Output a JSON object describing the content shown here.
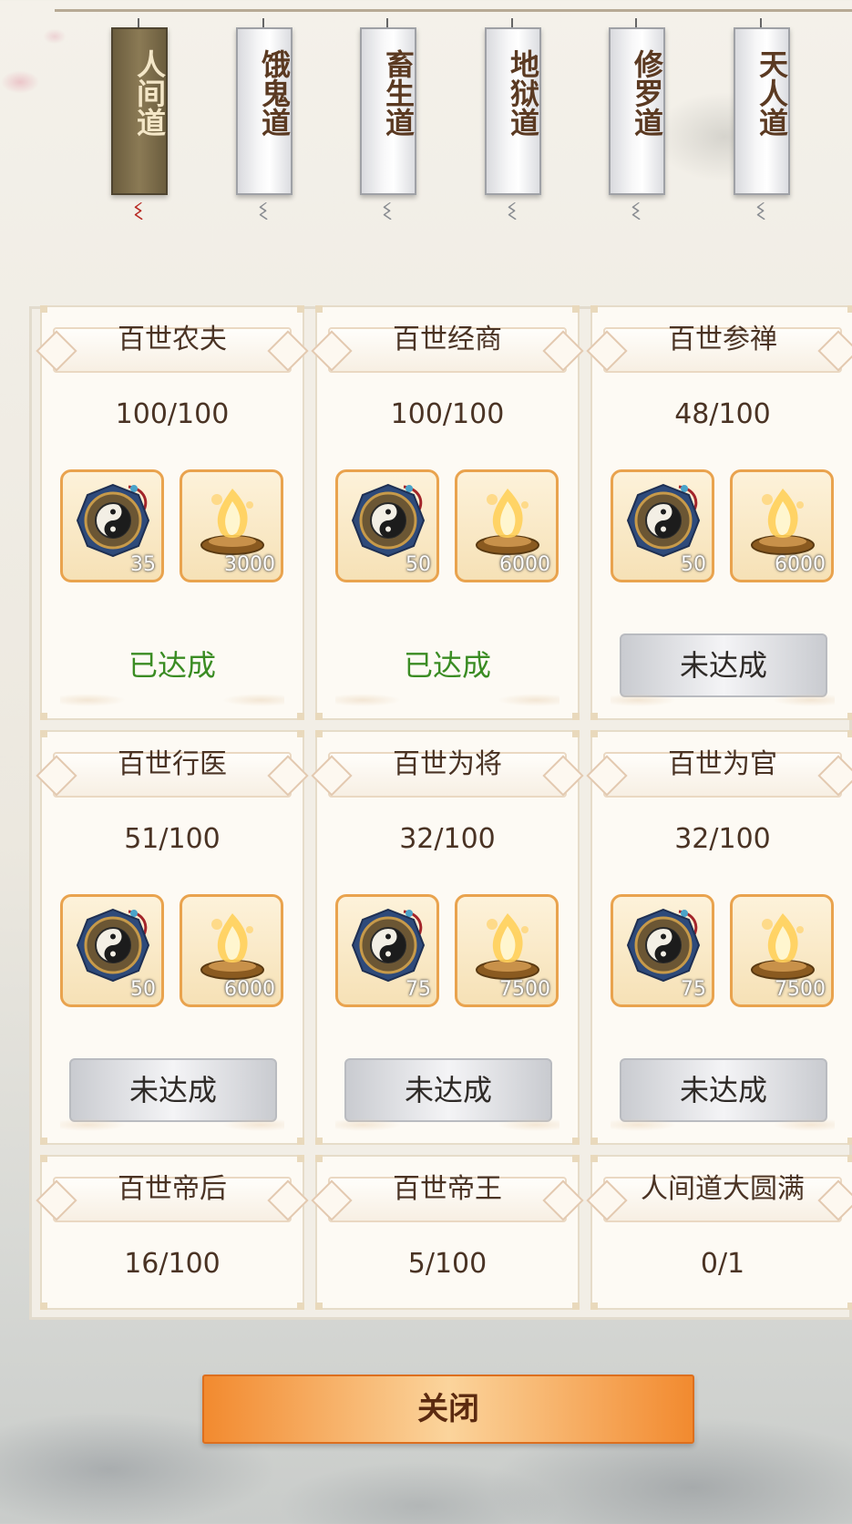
{
  "tabs": [
    {
      "label": "人间道",
      "active": true
    },
    {
      "label": "饿鬼道",
      "active": false
    },
    {
      "label": "畜生道",
      "active": false
    },
    {
      "label": "地狱道",
      "active": false
    },
    {
      "label": "修罗道",
      "active": false
    },
    {
      "label": "天人道",
      "active": false
    }
  ],
  "cards": [
    {
      "title": "百世农夫",
      "progress": "100/100",
      "rewards": [
        {
          "icon": "bagua-compass-icon",
          "qty": "35"
        },
        {
          "icon": "golden-flame-icon",
          "qty": "3000"
        }
      ],
      "status": "已达成",
      "completed": true
    },
    {
      "title": "百世经商",
      "progress": "100/100",
      "rewards": [
        {
          "icon": "bagua-compass-icon",
          "qty": "50"
        },
        {
          "icon": "golden-flame-icon",
          "qty": "6000"
        }
      ],
      "status": "已达成",
      "completed": true
    },
    {
      "title": "百世参禅",
      "progress": "48/100",
      "rewards": [
        {
          "icon": "bagua-compass-icon",
          "qty": "50"
        },
        {
          "icon": "golden-flame-icon",
          "qty": "6000"
        }
      ],
      "status": "未达成",
      "completed": false
    },
    {
      "title": "百世行医",
      "progress": "51/100",
      "rewards": [
        {
          "icon": "bagua-compass-icon",
          "qty": "50"
        },
        {
          "icon": "golden-flame-icon",
          "qty": "6000"
        }
      ],
      "status": "未达成",
      "completed": false
    },
    {
      "title": "百世为将",
      "progress": "32/100",
      "rewards": [
        {
          "icon": "bagua-compass-icon",
          "qty": "75"
        },
        {
          "icon": "golden-flame-icon",
          "qty": "7500"
        }
      ],
      "status": "未达成",
      "completed": false
    },
    {
      "title": "百世为官",
      "progress": "32/100",
      "rewards": [
        {
          "icon": "bagua-compass-icon",
          "qty": "75"
        },
        {
          "icon": "golden-flame-icon",
          "qty": "7500"
        }
      ],
      "status": "未达成",
      "completed": false
    },
    {
      "title": "百世帝后",
      "progress": "16/100"
    },
    {
      "title": "百世帝王",
      "progress": "5/100"
    },
    {
      "title": "人间道大圆满",
      "progress": "0/1"
    }
  ],
  "close_label": "关闭",
  "colors": {
    "done": "#3a8c23",
    "accent": "#f28a2f",
    "text": "#4a3324"
  }
}
